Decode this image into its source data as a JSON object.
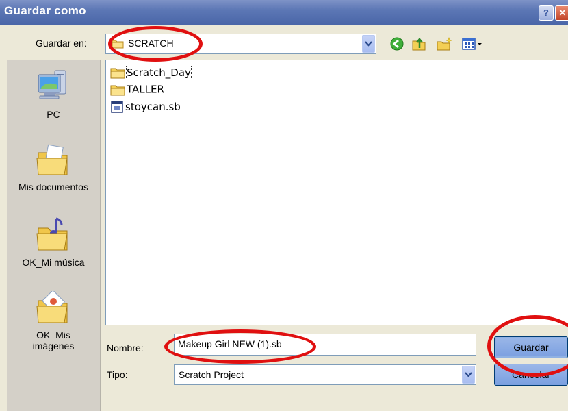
{
  "window": {
    "title": "Guardar como"
  },
  "location": {
    "label": "Guardar en:",
    "value": "SCRATCH"
  },
  "toolbar": {
    "icons": [
      "back-icon",
      "up-folder-icon",
      "new-folder-icon",
      "view-menu-icon"
    ]
  },
  "places": [
    {
      "label": "PC",
      "icon": "computer-icon"
    },
    {
      "label": "Mis documentos",
      "icon": "my-documents-icon"
    },
    {
      "label": "OK_Mi música",
      "icon": "my-music-icon"
    },
    {
      "label": "OK_Mis imágenes",
      "icon": "my-pictures-icon"
    }
  ],
  "files": [
    {
      "name": "Scratch_Day",
      "type": "folder"
    },
    {
      "name": "TALLER",
      "type": "folder"
    },
    {
      "name": "stoycan.sb",
      "type": "file"
    }
  ],
  "filename": {
    "label": "Nombre:",
    "value": "Makeup Girl NEW (1).sb"
  },
  "filetype": {
    "label": "Tipo:",
    "value": "Scratch Project"
  },
  "buttons": {
    "save": "Guardar",
    "cancel": "Cancelar"
  },
  "colors": {
    "highlight": "#e01010",
    "titlebar": "#5c77b5"
  }
}
